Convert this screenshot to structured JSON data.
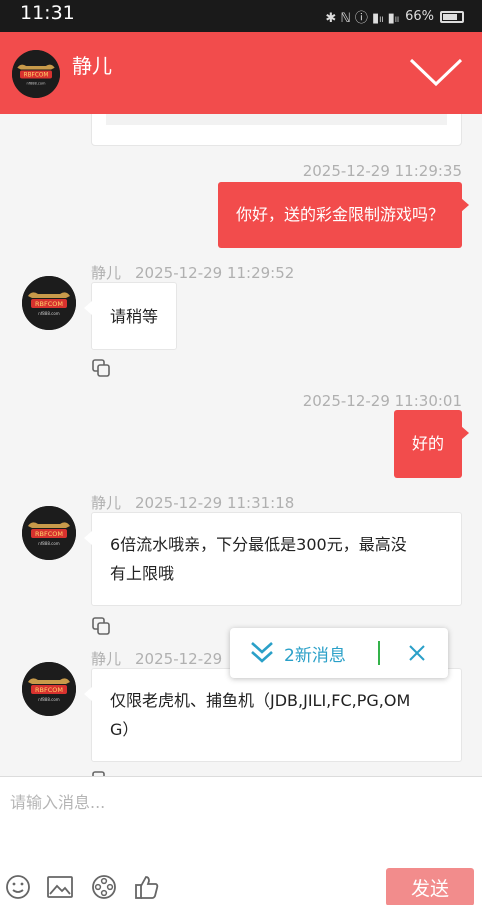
{
  "status_bar": {
    "time": "11:31",
    "icons_text": "✱ ℕ ⓘ  ▮ₗₗ ▮ₗₗ",
    "battery": "66%"
  },
  "header": {
    "contact_name": "静儿"
  },
  "brand": {
    "logo_text": "RBFCOM",
    "logo_url": "nf888.com",
    "accent": "#f24c4c"
  },
  "messages": [
    {
      "timestamp": "2025-12-29 11:29:35",
      "text": "你好，送的彩金限制游戏吗？"
    },
    {
      "name": "静儿",
      "timestamp": "2025-12-29 11:29:52",
      "text": "请稍等"
    },
    {
      "timestamp": "2025-12-29 11:30:01",
      "text": "好的"
    },
    {
      "name": "静儿",
      "timestamp": "2025-12-29 11:31:18",
      "line1": "6倍流水哦亲，下分最低是300元，最高没",
      "line2": "有上限哦"
    },
    {
      "name": "静儿",
      "timestamp": "2025-12-29",
      "line1": "仅限老虎机、捕鱼机（JDB,JILI,FC,PG,OM",
      "line2": "G）"
    }
  ],
  "new_message_banner": {
    "label": "2新消息"
  },
  "composer": {
    "placeholder": "请输入消息...",
    "value": "",
    "send_label": "发送"
  },
  "icons": [
    "emoji-icon",
    "image-icon",
    "video-icon",
    "thumbs-up-icon",
    "copy-icon",
    "chevron-down-icon",
    "close-icon"
  ]
}
